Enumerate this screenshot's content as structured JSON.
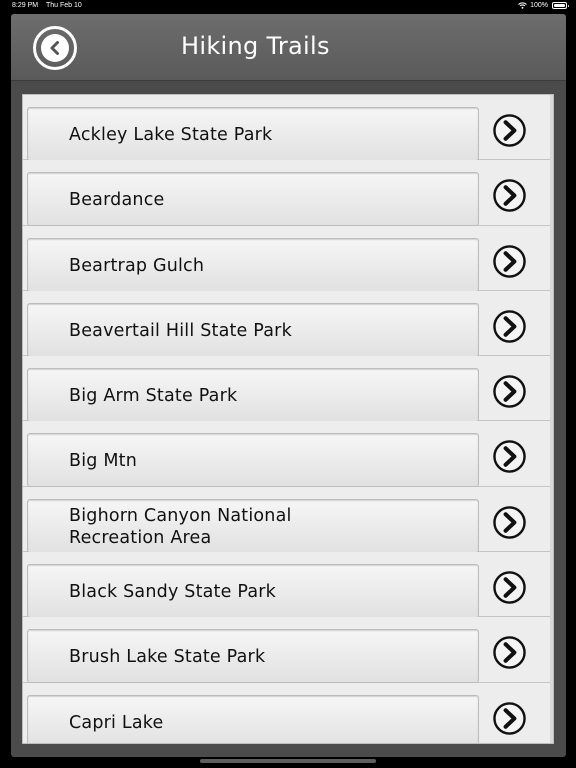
{
  "status_bar": {
    "time": "8:29 PM",
    "date": "Thu Feb 10",
    "battery": "100%"
  },
  "header": {
    "title": "Hiking Trails",
    "back_icon": "chevron-left-circle-icon"
  },
  "trails": [
    {
      "name": "Ackley Lake State Park"
    },
    {
      "name": "Beardance"
    },
    {
      "name": "Beartrap Gulch"
    },
    {
      "name": "Beavertail Hill State Park"
    },
    {
      "name": "Big Arm State Park"
    },
    {
      "name": "Big Mtn"
    },
    {
      "name": "Bighorn Canyon National\nRecreation Area"
    },
    {
      "name": "Black Sandy State Park"
    },
    {
      "name": "Brush Lake State Park"
    },
    {
      "name": "Capri Lake"
    }
  ],
  "colors": {
    "header_bg": "#5f5f5f",
    "panel_bg": "#ececec",
    "text": "#111111"
  }
}
